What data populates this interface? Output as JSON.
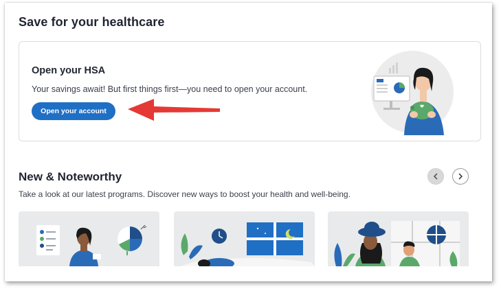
{
  "page": {
    "title": "Save for your healthcare"
  },
  "hsa": {
    "title": "Open your HSA",
    "description": "Your savings await! But first things first—you need to open your account.",
    "button_label": "Open your account"
  },
  "noteworthy": {
    "title": "New & Noteworthy",
    "subtitle": "Take a look at our latest programs. Discover new ways to boost your health and well-being."
  },
  "colors": {
    "primary_button": "#1f6fc5",
    "annotation_arrow": "#e53935",
    "illustration_blue": "#2a6bb8",
    "illustration_green": "#5aa96b"
  },
  "icons": {
    "prev": "chevron-left-icon",
    "next": "chevron-right-icon"
  }
}
